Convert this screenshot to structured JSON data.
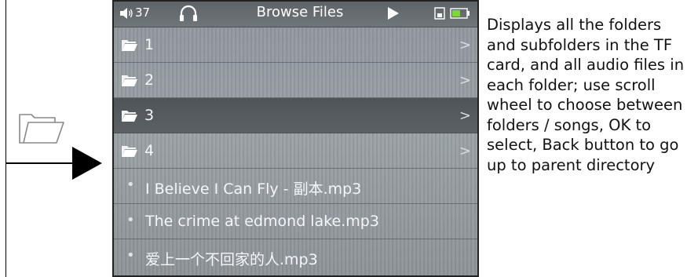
{
  "statusbar": {
    "volume_value": "37",
    "title": "Browse Files",
    "icons": [
      "volume-icon",
      "headphones-icon",
      "play-icon",
      "sd-card-icon",
      "battery-icon"
    ]
  },
  "folders": [
    {
      "label": "1",
      "selected": false
    },
    {
      "label": "2",
      "selected": false
    },
    {
      "label": "3",
      "selected": true
    },
    {
      "label": "4",
      "selected": false
    }
  ],
  "chevron": ">",
  "files": [
    {
      "label": "I Believe I Can Fly - 副本.mp3"
    },
    {
      "label": "The crime at edmond lake.mp3"
    },
    {
      "label": "爱上一个不回家的人.mp3"
    }
  ],
  "bullet": "•",
  "description": "Displays all the folders and subfolders in the TF card, and all audio files in each folder; use scroll wheel to choose between folders / songs, OK to select, Back button to go up to parent directory",
  "colors": {
    "screen_bg": "#979ea2",
    "statusbar_bg": "#63696d",
    "selected_row_bg": "#55595d",
    "text": "#f4f6f8"
  }
}
